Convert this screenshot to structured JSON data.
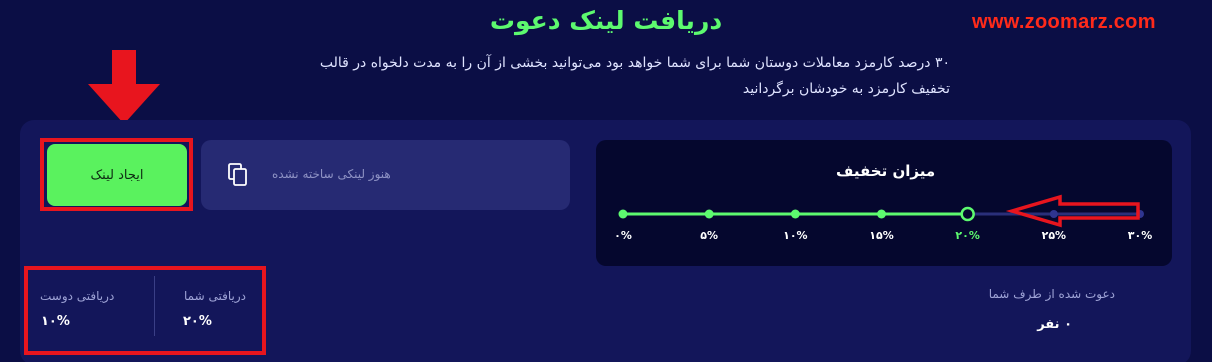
{
  "watermark": "www.zoomarz.com",
  "header": {
    "title": "دریافت لینک دعوت",
    "subtitle_line1": "۳۰ درصد کارمزد معاملات دوستان شما برای شما خواهد بود می‌توانید بخشی از آن را به مدت دلخواه در قالب",
    "subtitle_line2": "تخفیف کارمزد به خودشان برگردانید"
  },
  "link": {
    "create_button_label": "ایجاد لینک",
    "placeholder_text": "هنوز لینکی ساخته نشده"
  },
  "discount": {
    "title": "میزان تخفیف",
    "levels": [
      "۰%",
      "۵%",
      "۱۰%",
      "۱۵%",
      "۲۰%",
      "۲۵%",
      "۳۰%"
    ],
    "selected_level": "۲۰%",
    "selected_fraction": 0.667
  },
  "stats": {
    "invited_label": "دعوت شده از طرف شما",
    "invited_value": "۰ نفر",
    "your_share_label": "دریافتی شما",
    "your_share_value": "۲۰%",
    "friend_share_label": "دریافتی دوست",
    "friend_share_value": "۱۰%"
  },
  "colors": {
    "accent_green": "#5dfa6f",
    "annotation_red": "#e8151e",
    "background": "#0b0e45"
  },
  "icons": [
    "copy-icon",
    "down-arrow-annotation",
    "left-arrow-annotation"
  ]
}
